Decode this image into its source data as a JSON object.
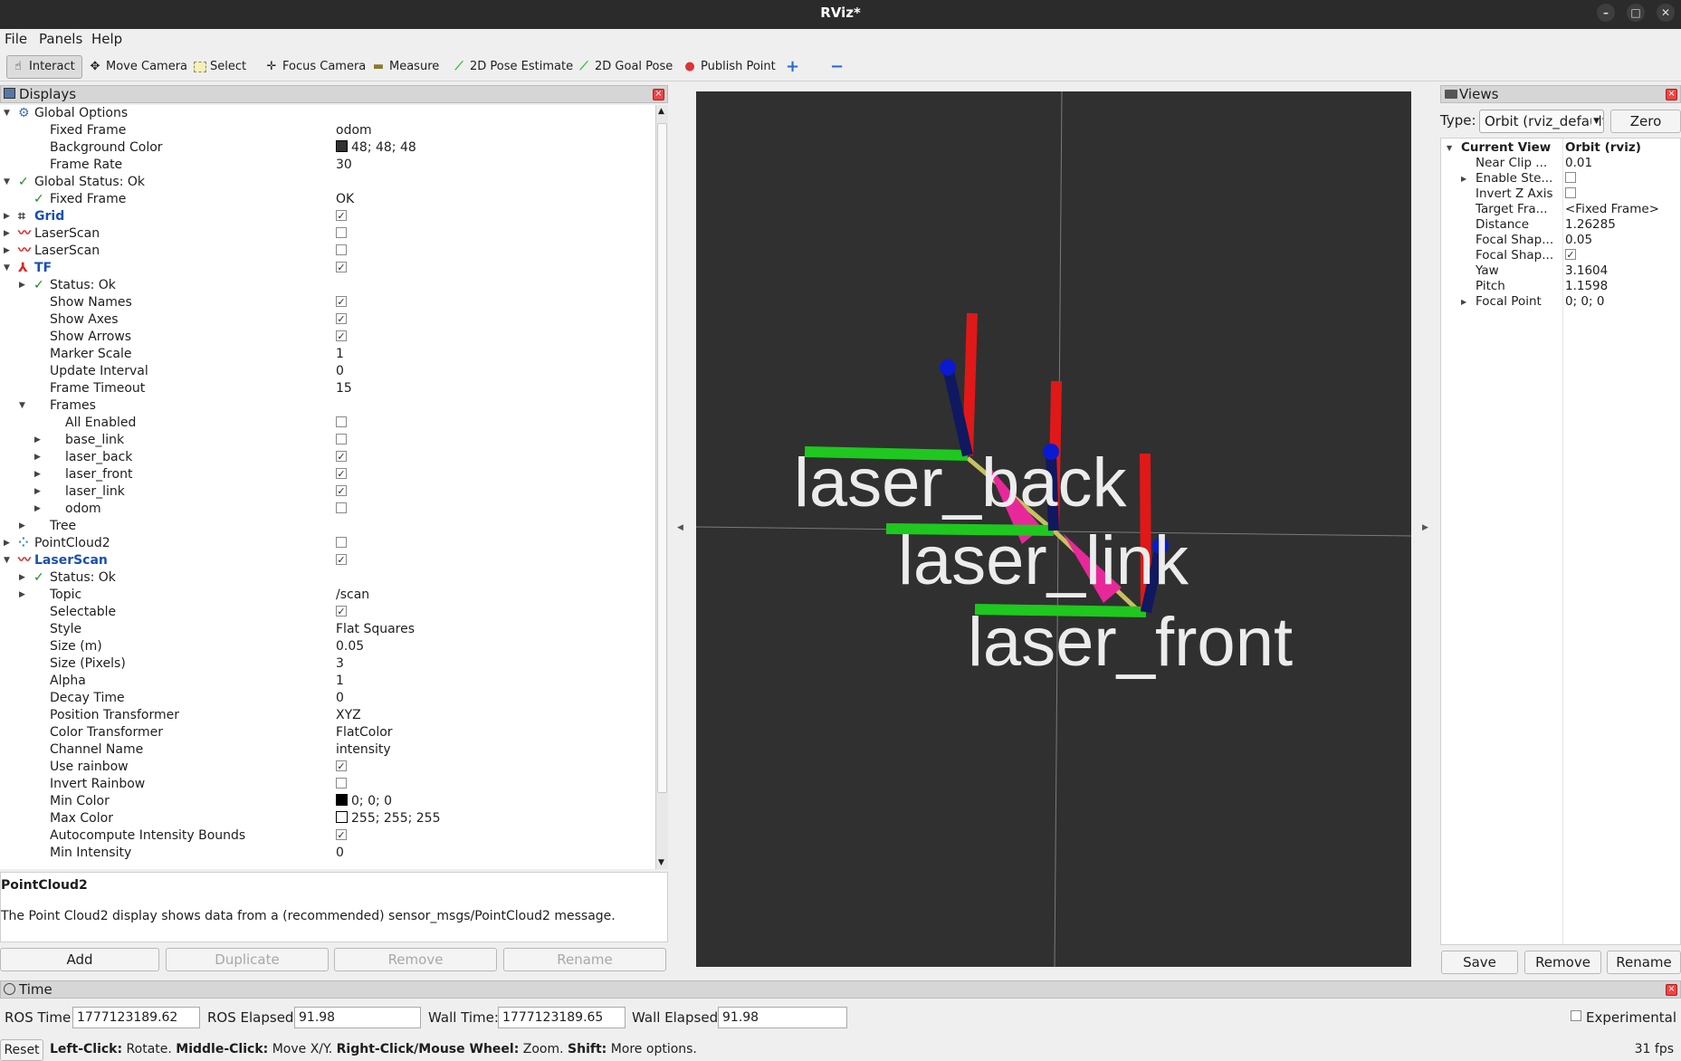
{
  "window": {
    "title": "RViz*"
  },
  "menu": {
    "file": "File",
    "panels": "Panels",
    "help": "Help"
  },
  "toolbar": {
    "interact": "Interact",
    "move_camera": "Move Camera",
    "select": "Select",
    "focus_camera": "Focus Camera",
    "measure": "Measure",
    "pose_estimate": "2D Pose Estimate",
    "goal_pose": "2D Goal Pose",
    "publish_point": "Publish Point",
    "plus": "+",
    "minus": "−"
  },
  "displays": {
    "title": "Displays",
    "rows": [
      {
        "label": "Global Options",
        "value": "",
        "indent": 0,
        "arrow": "open",
        "icon": "gear"
      },
      {
        "label": "Fixed Frame",
        "value": "odom",
        "indent": 1
      },
      {
        "label": "Background Color",
        "value": "48; 48; 48",
        "indent": 1,
        "swatch": "#303030"
      },
      {
        "label": "Frame Rate",
        "value": "30",
        "indent": 1
      },
      {
        "label": "Global Status: Ok",
        "value": "",
        "indent": 0,
        "arrow": "open",
        "icon": "ok"
      },
      {
        "label": "Fixed Frame",
        "value": "OK",
        "indent": 1,
        "icon": "ok"
      },
      {
        "label": "Grid",
        "value": "",
        "indent": 0,
        "arrow": "closed",
        "icon": "grid",
        "bold": true,
        "check": true
      },
      {
        "label": "LaserScan",
        "value": "",
        "indent": 0,
        "arrow": "closed",
        "icon": "laser",
        "check": false
      },
      {
        "label": "LaserScan",
        "value": "",
        "indent": 0,
        "arrow": "closed",
        "icon": "laser",
        "check": false
      },
      {
        "label": "TF",
        "value": "",
        "indent": 0,
        "arrow": "open",
        "icon": "tf",
        "bold": true,
        "check": true
      },
      {
        "label": "Status: Ok",
        "value": "",
        "indent": 1,
        "arrow": "closed",
        "icon": "ok"
      },
      {
        "label": "Show Names",
        "value": "",
        "indent": 1,
        "check": true
      },
      {
        "label": "Show Axes",
        "value": "",
        "indent": 1,
        "check": true
      },
      {
        "label": "Show Arrows",
        "value": "",
        "indent": 1,
        "check": true
      },
      {
        "label": "Marker Scale",
        "value": "1",
        "indent": 1
      },
      {
        "label": "Update Interval",
        "value": "0",
        "indent": 1
      },
      {
        "label": "Frame Timeout",
        "value": "15",
        "indent": 1
      },
      {
        "label": "Frames",
        "value": "",
        "indent": 1,
        "arrow": "open"
      },
      {
        "label": "All Enabled",
        "value": "",
        "indent": 2,
        "check": false
      },
      {
        "label": "base_link",
        "value": "",
        "indent": 2,
        "arrow": "closed",
        "check": false
      },
      {
        "label": "laser_back",
        "value": "",
        "indent": 2,
        "arrow": "closed",
        "check": true
      },
      {
        "label": "laser_front",
        "value": "",
        "indent": 2,
        "arrow": "closed",
        "check": true
      },
      {
        "label": "laser_link",
        "value": "",
        "indent": 2,
        "arrow": "closed",
        "check": true
      },
      {
        "label": "odom",
        "value": "",
        "indent": 2,
        "arrow": "closed",
        "check": false
      },
      {
        "label": "Tree",
        "value": "",
        "indent": 1,
        "arrow": "closed"
      },
      {
        "label": "PointCloud2",
        "value": "",
        "indent": 0,
        "arrow": "closed",
        "icon": "cloud",
        "check": false
      },
      {
        "label": "LaserScan",
        "value": "",
        "indent": 0,
        "arrow": "open",
        "icon": "laser",
        "bold": true,
        "check": true
      },
      {
        "label": "Status: Ok",
        "value": "",
        "indent": 1,
        "arrow": "closed",
        "icon": "ok"
      },
      {
        "label": "Topic",
        "value": "/scan",
        "indent": 1,
        "arrow": "closed"
      },
      {
        "label": "Selectable",
        "value": "",
        "indent": 1,
        "check": true
      },
      {
        "label": "Style",
        "value": "Flat Squares",
        "indent": 1
      },
      {
        "label": "Size (m)",
        "value": "0.05",
        "indent": 1
      },
      {
        "label": "Size (Pixels)",
        "value": "3",
        "indent": 1
      },
      {
        "label": "Alpha",
        "value": "1",
        "indent": 1
      },
      {
        "label": "Decay Time",
        "value": "0",
        "indent": 1
      },
      {
        "label": "Position Transformer",
        "value": "XYZ",
        "indent": 1
      },
      {
        "label": "Color Transformer",
        "value": "FlatColor",
        "indent": 1
      },
      {
        "label": "Channel Name",
        "value": "intensity",
        "indent": 1
      },
      {
        "label": "Use rainbow",
        "value": "",
        "indent": 1,
        "check": true
      },
      {
        "label": "Invert Rainbow",
        "value": "",
        "indent": 1,
        "check": false
      },
      {
        "label": "Min Color",
        "value": "0; 0; 0",
        "indent": 1,
        "swatch": "#000000"
      },
      {
        "label": "Max Color",
        "value": "255; 255; 255",
        "indent": 1,
        "swatch": "#ffffff"
      },
      {
        "label": "Autocompute Intensity Bounds",
        "value": "",
        "indent": 1,
        "check": true
      },
      {
        "label": "Min Intensity",
        "value": "0",
        "indent": 1
      }
    ],
    "description_title": "PointCloud2",
    "description_text": "The Point Cloud2 display shows data from a (recommended) sensor_msgs/PointCloud2 message.",
    "buttons": {
      "add": "Add",
      "duplicate": "Duplicate",
      "remove": "Remove",
      "rename": "Rename"
    }
  },
  "viewport": {
    "labels": [
      "laser_back",
      "laser_link",
      "laser_front"
    ],
    "background": "#303030"
  },
  "views": {
    "title": "Views",
    "type_label": "Type:",
    "type_value": "Orbit (rviz_default",
    "zero": "Zero",
    "current_view": "Current View",
    "current_view_value": "Orbit (rviz)",
    "rows": [
      {
        "label": "Near Clip ...",
        "value": "0.01"
      },
      {
        "label": "Enable Ste...",
        "value": "",
        "check": false,
        "arrow": true
      },
      {
        "label": "Invert Z Axis",
        "value": "",
        "check": false
      },
      {
        "label": "Target Fra...",
        "value": "<Fixed Frame>"
      },
      {
        "label": "Distance",
        "value": "1.26285"
      },
      {
        "label": "Focal Shap...",
        "value": "0.05"
      },
      {
        "label": "Focal Shap...",
        "value": "",
        "check": true
      },
      {
        "label": "Yaw",
        "value": "3.1604"
      },
      {
        "label": "Pitch",
        "value": "1.1598"
      },
      {
        "label": "Focal Point",
        "value": "0; 0; 0",
        "arrow": true
      }
    ],
    "buttons": {
      "save": "Save",
      "remove": "Remove",
      "rename": "Rename"
    }
  },
  "time": {
    "title": "Time",
    "ros_time_label": "ROS Time:",
    "ros_time": "1777123189.62",
    "ros_elapsed_label": "ROS Elapsed:",
    "ros_elapsed": "91.98",
    "wall_time_label": "Wall Time:",
    "wall_time": "1777123189.65",
    "wall_elapsed_label": "Wall Elapsed:",
    "wall_elapsed": "91.98",
    "experimental": "Experimental"
  },
  "status": {
    "reset": "Reset",
    "left_click": "Left-Click:",
    "left_click_text": " Rotate. ",
    "middle_click": "Middle-Click:",
    "middle_click_text": " Move X/Y. ",
    "right_click": "Right-Click/Mouse Wheel:",
    "right_click_text": " Zoom. ",
    "shift": "Shift:",
    "shift_text": " More options.",
    "fps": "31 fps"
  }
}
